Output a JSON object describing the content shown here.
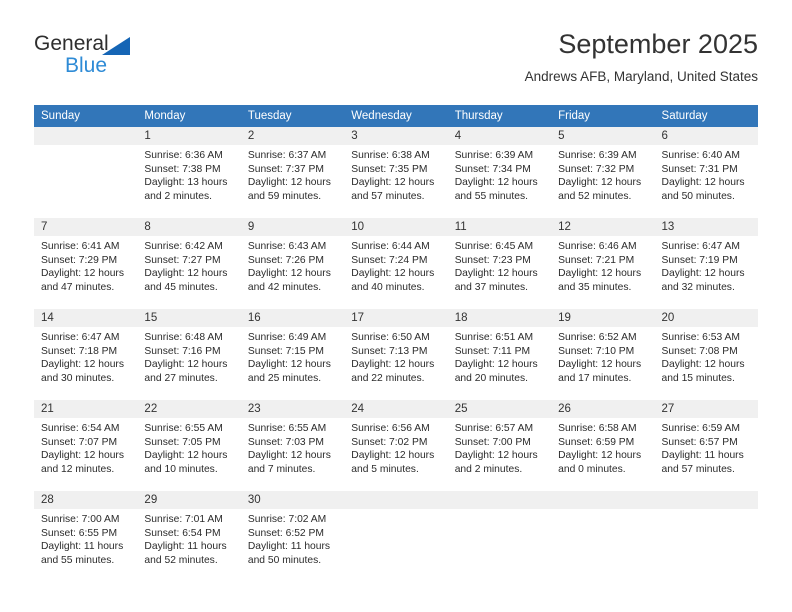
{
  "brand": {
    "name_part1": "General",
    "name_part2": "Blue",
    "logo_icon": "blue-triangle-logo"
  },
  "header": {
    "title": "September 2025",
    "subtitle": "Andrews AFB, Maryland, United States"
  },
  "colors": {
    "header_blue": "#3276b9",
    "brand_blue": "#2e8bd6",
    "logo_triangle_blue": "#1565b5",
    "day_number_band": "#f0f0f0",
    "text": "#333333"
  },
  "calendar": {
    "weekday_headers": [
      "Sunday",
      "Monday",
      "Tuesday",
      "Wednesday",
      "Thursday",
      "Friday",
      "Saturday"
    ],
    "weeks": [
      [
        {
          "day": "",
          "blank": true,
          "sunrise": "",
          "sunset": "",
          "daylight_line1": "",
          "daylight_line2": ""
        },
        {
          "day": "1",
          "sunrise": "Sunrise: 6:36 AM",
          "sunset": "Sunset: 7:38 PM",
          "daylight_line1": "Daylight: 13 hours",
          "daylight_line2": "and 2 minutes."
        },
        {
          "day": "2",
          "sunrise": "Sunrise: 6:37 AM",
          "sunset": "Sunset: 7:37 PM",
          "daylight_line1": "Daylight: 12 hours",
          "daylight_line2": "and 59 minutes."
        },
        {
          "day": "3",
          "sunrise": "Sunrise: 6:38 AM",
          "sunset": "Sunset: 7:35 PM",
          "daylight_line1": "Daylight: 12 hours",
          "daylight_line2": "and 57 minutes."
        },
        {
          "day": "4",
          "sunrise": "Sunrise: 6:39 AM",
          "sunset": "Sunset: 7:34 PM",
          "daylight_line1": "Daylight: 12 hours",
          "daylight_line2": "and 55 minutes."
        },
        {
          "day": "5",
          "sunrise": "Sunrise: 6:39 AM",
          "sunset": "Sunset: 7:32 PM",
          "daylight_line1": "Daylight: 12 hours",
          "daylight_line2": "and 52 minutes."
        },
        {
          "day": "6",
          "sunrise": "Sunrise: 6:40 AM",
          "sunset": "Sunset: 7:31 PM",
          "daylight_line1": "Daylight: 12 hours",
          "daylight_line2": "and 50 minutes."
        }
      ],
      [
        {
          "day": "7",
          "sunrise": "Sunrise: 6:41 AM",
          "sunset": "Sunset: 7:29 PM",
          "daylight_line1": "Daylight: 12 hours",
          "daylight_line2": "and 47 minutes."
        },
        {
          "day": "8",
          "sunrise": "Sunrise: 6:42 AM",
          "sunset": "Sunset: 7:27 PM",
          "daylight_line1": "Daylight: 12 hours",
          "daylight_line2": "and 45 minutes."
        },
        {
          "day": "9",
          "sunrise": "Sunrise: 6:43 AM",
          "sunset": "Sunset: 7:26 PM",
          "daylight_line1": "Daylight: 12 hours",
          "daylight_line2": "and 42 minutes."
        },
        {
          "day": "10",
          "sunrise": "Sunrise: 6:44 AM",
          "sunset": "Sunset: 7:24 PM",
          "daylight_line1": "Daylight: 12 hours",
          "daylight_line2": "and 40 minutes."
        },
        {
          "day": "11",
          "sunrise": "Sunrise: 6:45 AM",
          "sunset": "Sunset: 7:23 PM",
          "daylight_line1": "Daylight: 12 hours",
          "daylight_line2": "and 37 minutes."
        },
        {
          "day": "12",
          "sunrise": "Sunrise: 6:46 AM",
          "sunset": "Sunset: 7:21 PM",
          "daylight_line1": "Daylight: 12 hours",
          "daylight_line2": "and 35 minutes."
        },
        {
          "day": "13",
          "sunrise": "Sunrise: 6:47 AM",
          "sunset": "Sunset: 7:19 PM",
          "daylight_line1": "Daylight: 12 hours",
          "daylight_line2": "and 32 minutes."
        }
      ],
      [
        {
          "day": "14",
          "sunrise": "Sunrise: 6:47 AM",
          "sunset": "Sunset: 7:18 PM",
          "daylight_line1": "Daylight: 12 hours",
          "daylight_line2": "and 30 minutes."
        },
        {
          "day": "15",
          "sunrise": "Sunrise: 6:48 AM",
          "sunset": "Sunset: 7:16 PM",
          "daylight_line1": "Daylight: 12 hours",
          "daylight_line2": "and 27 minutes."
        },
        {
          "day": "16",
          "sunrise": "Sunrise: 6:49 AM",
          "sunset": "Sunset: 7:15 PM",
          "daylight_line1": "Daylight: 12 hours",
          "daylight_line2": "and 25 minutes."
        },
        {
          "day": "17",
          "sunrise": "Sunrise: 6:50 AM",
          "sunset": "Sunset: 7:13 PM",
          "daylight_line1": "Daylight: 12 hours",
          "daylight_line2": "and 22 minutes."
        },
        {
          "day": "18",
          "sunrise": "Sunrise: 6:51 AM",
          "sunset": "Sunset: 7:11 PM",
          "daylight_line1": "Daylight: 12 hours",
          "daylight_line2": "and 20 minutes."
        },
        {
          "day": "19",
          "sunrise": "Sunrise: 6:52 AM",
          "sunset": "Sunset: 7:10 PM",
          "daylight_line1": "Daylight: 12 hours",
          "daylight_line2": "and 17 minutes."
        },
        {
          "day": "20",
          "sunrise": "Sunrise: 6:53 AM",
          "sunset": "Sunset: 7:08 PM",
          "daylight_line1": "Daylight: 12 hours",
          "daylight_line2": "and 15 minutes."
        }
      ],
      [
        {
          "day": "21",
          "sunrise": "Sunrise: 6:54 AM",
          "sunset": "Sunset: 7:07 PM",
          "daylight_line1": "Daylight: 12 hours",
          "daylight_line2": "and 12 minutes."
        },
        {
          "day": "22",
          "sunrise": "Sunrise: 6:55 AM",
          "sunset": "Sunset: 7:05 PM",
          "daylight_line1": "Daylight: 12 hours",
          "daylight_line2": "and 10 minutes."
        },
        {
          "day": "23",
          "sunrise": "Sunrise: 6:55 AM",
          "sunset": "Sunset: 7:03 PM",
          "daylight_line1": "Daylight: 12 hours",
          "daylight_line2": "and 7 minutes."
        },
        {
          "day": "24",
          "sunrise": "Sunrise: 6:56 AM",
          "sunset": "Sunset: 7:02 PM",
          "daylight_line1": "Daylight: 12 hours",
          "daylight_line2": "and 5 minutes."
        },
        {
          "day": "25",
          "sunrise": "Sunrise: 6:57 AM",
          "sunset": "Sunset: 7:00 PM",
          "daylight_line1": "Daylight: 12 hours",
          "daylight_line2": "and 2 minutes."
        },
        {
          "day": "26",
          "sunrise": "Sunrise: 6:58 AM",
          "sunset": "Sunset: 6:59 PM",
          "daylight_line1": "Daylight: 12 hours",
          "daylight_line2": "and 0 minutes."
        },
        {
          "day": "27",
          "sunrise": "Sunrise: 6:59 AM",
          "sunset": "Sunset: 6:57 PM",
          "daylight_line1": "Daylight: 11 hours",
          "daylight_line2": "and 57 minutes."
        }
      ],
      [
        {
          "day": "28",
          "sunrise": "Sunrise: 7:00 AM",
          "sunset": "Sunset: 6:55 PM",
          "daylight_line1": "Daylight: 11 hours",
          "daylight_line2": "and 55 minutes."
        },
        {
          "day": "29",
          "sunrise": "Sunrise: 7:01 AM",
          "sunset": "Sunset: 6:54 PM",
          "daylight_line1": "Daylight: 11 hours",
          "daylight_line2": "and 52 minutes."
        },
        {
          "day": "30",
          "sunrise": "Sunrise: 7:02 AM",
          "sunset": "Sunset: 6:52 PM",
          "daylight_line1": "Daylight: 11 hours",
          "daylight_line2": "and 50 minutes."
        },
        {
          "day": "",
          "blank": true,
          "sunrise": "",
          "sunset": "",
          "daylight_line1": "",
          "daylight_line2": ""
        },
        {
          "day": "",
          "blank": true,
          "sunrise": "",
          "sunset": "",
          "daylight_line1": "",
          "daylight_line2": ""
        },
        {
          "day": "",
          "blank": true,
          "sunrise": "",
          "sunset": "",
          "daylight_line1": "",
          "daylight_line2": ""
        },
        {
          "day": "",
          "blank": true,
          "sunrise": "",
          "sunset": "",
          "daylight_line1": "",
          "daylight_line2": ""
        }
      ]
    ]
  }
}
